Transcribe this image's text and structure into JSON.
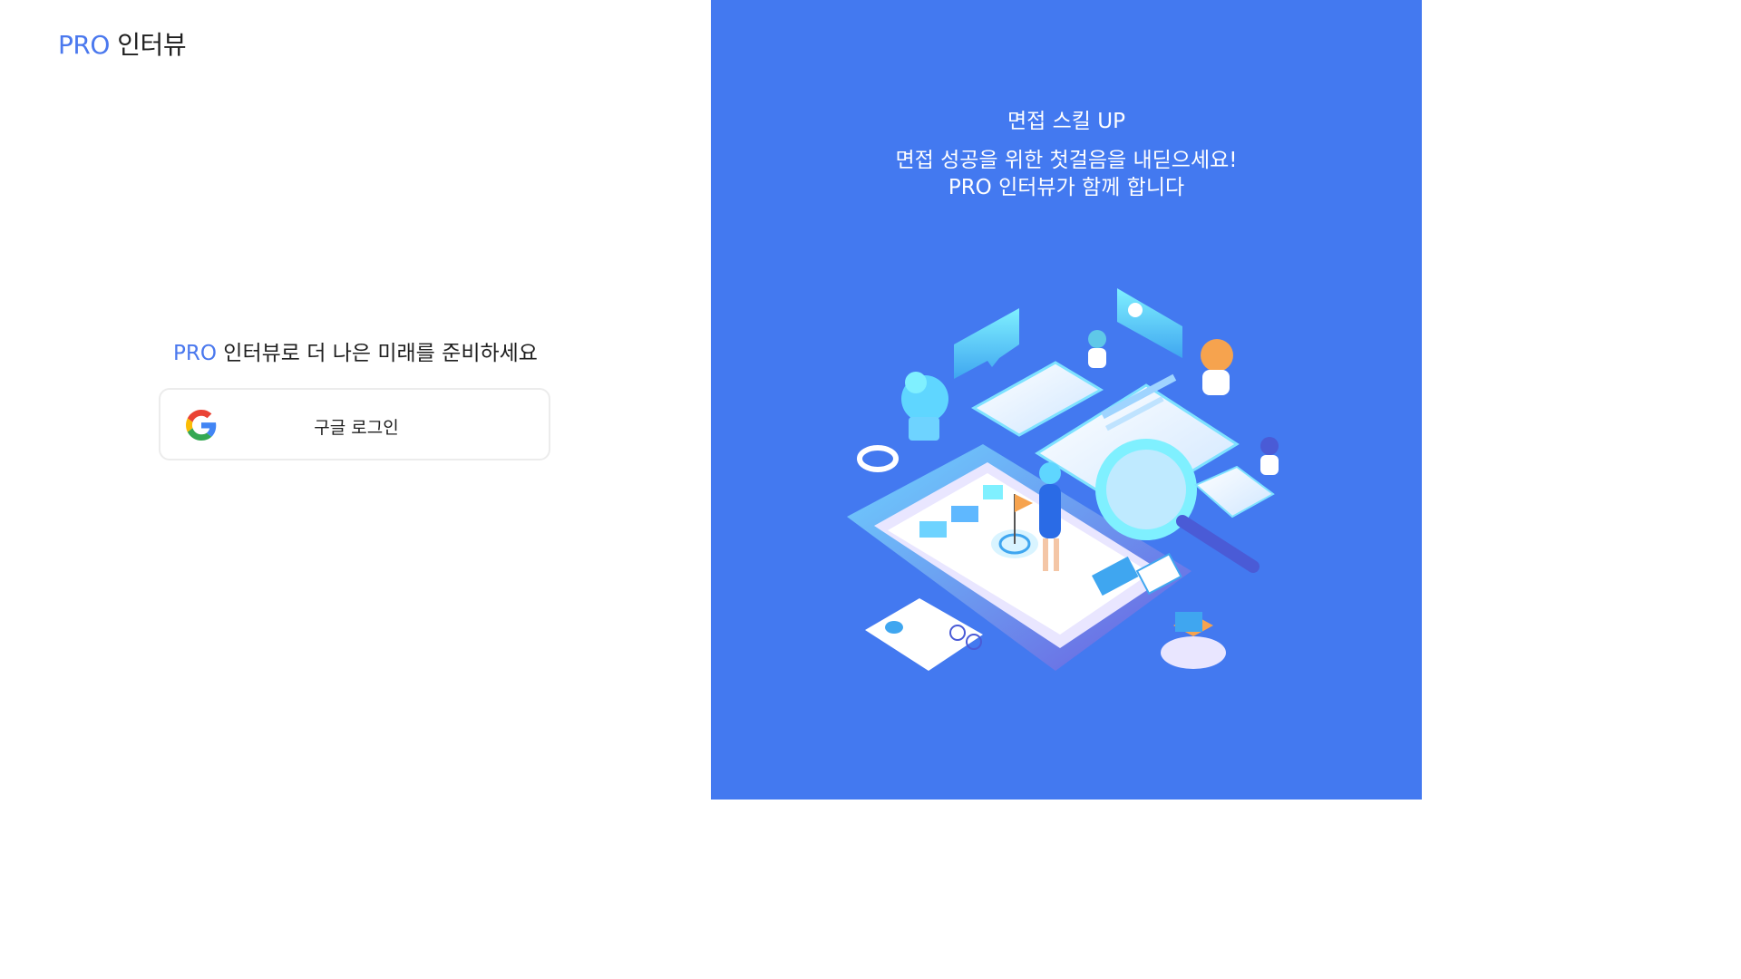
{
  "brand": {
    "accent": "PRO",
    "name": "인터뷰"
  },
  "login": {
    "tagline_accent": "PRO",
    "tagline_rest": " 인터뷰로 더 나은 미래를 준비하세요",
    "google_label": "구글 로그인",
    "google_icon": "google-g-icon"
  },
  "promo": {
    "title": "면접 스킬 UP",
    "line1": "면접 성공을 위한 첫걸음을 내딛으세요!",
    "line2": "PRO 인터뷰가 함께 합니다",
    "illustration": "isometric-interview-illustration"
  },
  "colors": {
    "brand_blue": "#4a78ee",
    "panel_blue": "#4379f0",
    "text": "#1f1f1f"
  }
}
